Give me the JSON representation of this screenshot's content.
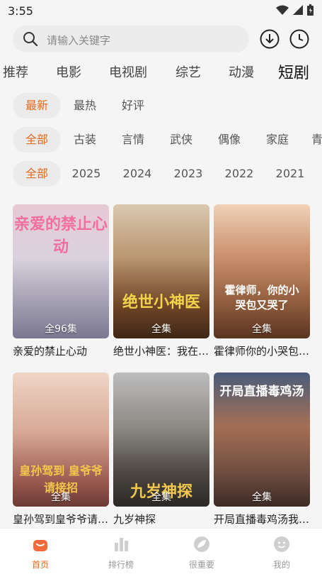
{
  "status": {
    "time": "3:55"
  },
  "search": {
    "placeholder": "请输入关键字"
  },
  "category_tabs": [
    "推荐",
    "电影",
    "电视剧",
    "综艺",
    "动漫",
    "短剧"
  ],
  "sort_filters": [
    "最新",
    "最热",
    "好评"
  ],
  "genre_filters": [
    "全部",
    "古装",
    "言情",
    "武侠",
    "偶像",
    "家庭",
    "青"
  ],
  "year_filters": [
    "全部",
    "2025",
    "2024",
    "2023",
    "2022",
    "2021"
  ],
  "cards": [
    {
      "title": "亲爱的禁止心动",
      "episodes": "全96集",
      "poster_text": "亲爱的禁止心动"
    },
    {
      "title": "绝世小神医：我在山村觉醒神术",
      "episodes": "全集",
      "poster_text": "绝世小神医"
    },
    {
      "title": "霍律师你的小哭包又哭了",
      "episodes": "全集",
      "poster_text": "霍律师，你的小哭包又哭了"
    },
    {
      "title": "皇孙驾到皇爷爷请接招",
      "episodes": "全集",
      "poster_text": "皇孙驾到 皇爷爷请接招"
    },
    {
      "title": "九岁神探",
      "episodes": "全集",
      "poster_text": "九岁神探"
    },
    {
      "title": "开局直播毒鸡汤我成了顶流",
      "episodes": "全集",
      "poster_text": "开局直播毒鸡汤"
    }
  ],
  "bottom_nav": [
    {
      "label": "首页",
      "icon": "home-icon"
    },
    {
      "label": "排行榜",
      "icon": "chart-icon"
    },
    {
      "label": "很重要",
      "icon": "leaf-icon"
    },
    {
      "label": "我的",
      "icon": "profile-icon"
    }
  ],
  "colors": {
    "accent": "#e86a1c",
    "background": "#f5f5f5"
  }
}
